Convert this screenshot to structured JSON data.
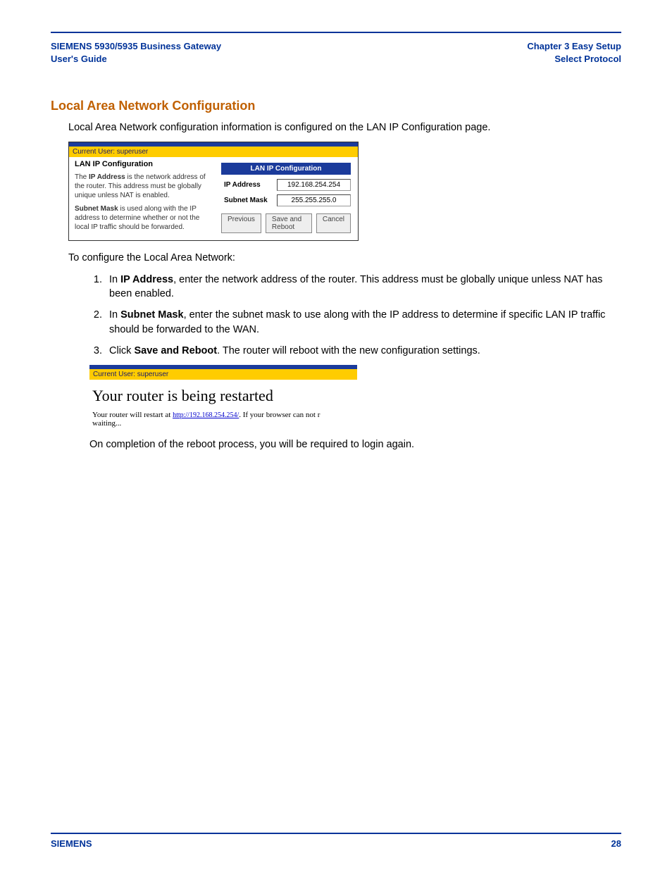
{
  "header": {
    "left_line1": "SIEMENS 5930/5935 Business Gateway",
    "left_line2": "User's Guide",
    "right_line1": "Chapter 3  Easy Setup",
    "right_line2": "Select Protocol"
  },
  "title": "Local Area Network Configuration",
  "intro": "Local Area Network configuration information is configured on the LAN IP Configuration page.",
  "screenshot1": {
    "current_user": "Current User: superuser",
    "panel_title": "LAN IP Configuration",
    "help_p1_pre": "The ",
    "help_p1_bold": "IP Address",
    "help_p1_post": " is the network address of the router. This address must be globally unique unless NAT is enabled.",
    "help_p2_bold": "Subnet Mask",
    "help_p2_post": " is used along with the IP address to determine whether or not the local IP traffic should be forwarded.",
    "right_title": "LAN IP Configuration",
    "ip_label": "IP Address",
    "ip_value": "192.168.254.254",
    "mask_label": "Subnet Mask",
    "mask_value": "255.255.255.0",
    "btn_prev": "Previous",
    "btn_save": "Save and Reboot",
    "btn_cancel": "Cancel"
  },
  "lead_in": "To configure the Local Area Network:",
  "steps": {
    "s1_pre": "In ",
    "s1_bold": "IP Address",
    "s1_post": ", enter the network address of the router. This address must be globally unique unless NAT has been enabled.",
    "s2_pre": "In ",
    "s2_bold": "Subnet Mask",
    "s2_post": ", enter the subnet mask to use along with the IP address to determine if specific LAN IP traffic should be forwarded to the WAN.",
    "s3_pre": "Click ",
    "s3_bold": "Save and Reboot",
    "s3_post": ". The router will reboot with the new configuration settings."
  },
  "screenshot2": {
    "current_user": "Current User: superuser",
    "heading": "Your router is being restarted",
    "msg_pre": "Your router will restart at ",
    "link": "http://192.168.254.254/",
    "msg_post1": ". If your browser can not r",
    "msg_post2": "waiting..."
  },
  "closing": "On completion of the reboot process, you will be required to login again.",
  "footer": {
    "brand": "SIEMENS",
    "page_num": "28"
  }
}
